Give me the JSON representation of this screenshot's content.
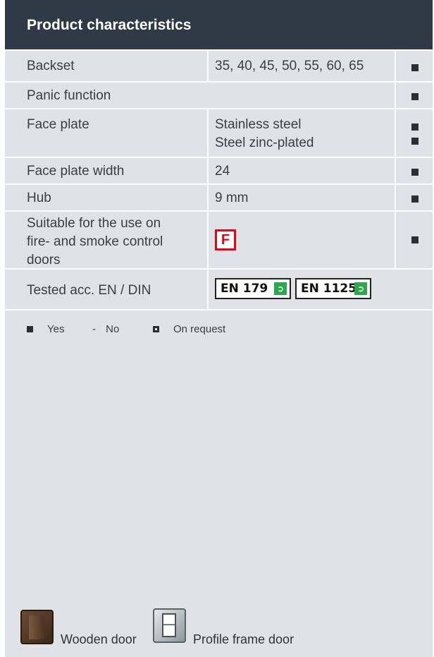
{
  "header": {
    "title": "Product characteristics"
  },
  "rows": [
    {
      "label": "Backset",
      "value": "35, 40, 45, 50, 55, 60, 65",
      "mark": "yes"
    },
    {
      "label": "Panic function",
      "value": "",
      "mark": "yes"
    },
    {
      "label": "Face plate",
      "value_lines": [
        "Stainless steel",
        "Steel zinc-plated"
      ],
      "marks": [
        "yes",
        "yes"
      ]
    },
    {
      "label": "Face plate width",
      "value": "24",
      "mark": "yes"
    },
    {
      "label": "Hub",
      "value": "9 mm",
      "mark": "yes"
    },
    {
      "label_lines": [
        "Suitable for the use on",
        "fire- and smoke control",
        "doors"
      ],
      "badge": "F",
      "badge_color": "#e30613",
      "mark": "yes"
    },
    {
      "label": "Tested acc. EN / DIN",
      "badges": [
        "EN 179",
        "EN 1125"
      ],
      "badge_icon": "running-man-exit-icon"
    }
  ],
  "legend": {
    "yes": "Yes",
    "no": "No",
    "no_symbol": "-",
    "on_request": "On request"
  },
  "doors": {
    "wooden": "Wooden door",
    "profile": "Profile frame door"
  }
}
